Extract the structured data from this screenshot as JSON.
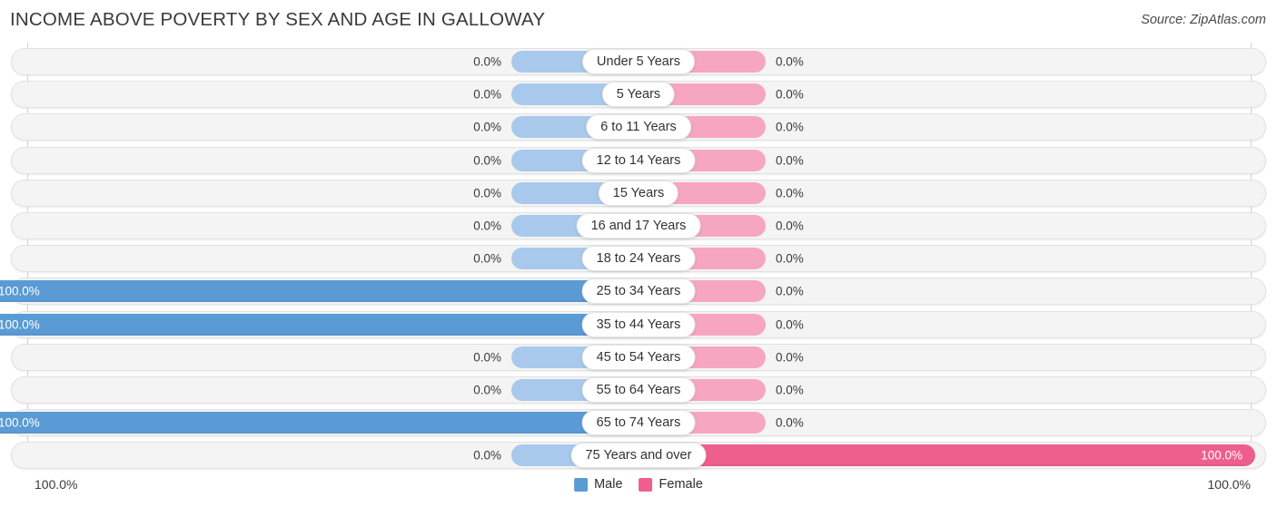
{
  "header": {
    "title": "INCOME ABOVE POVERTY BY SEX AND AGE IN GALLOWAY",
    "source": "Source: ZipAtlas.com"
  },
  "legend": {
    "male_label": "Male",
    "female_label": "Female",
    "male_color": "#5b9bd5",
    "female_color": "#ef5f8d"
  },
  "axis": {
    "left_label": "100.0%",
    "right_label": "100.0%"
  },
  "colors": {
    "male_light": "#a9c9ec",
    "male_full": "#5b9bd5",
    "female_light": "#f7a6c2",
    "female_full": "#ef5f8d",
    "track": "#f4f4f4"
  },
  "chart_data": {
    "type": "bar",
    "title": "INCOME ABOVE POVERTY BY SEX AND AGE IN GALLOWAY",
    "subtitle": "Source: ZipAtlas.com",
    "orientation": "horizontal",
    "style": "diverging-bidirectional",
    "xlabel": "",
    "ylabel": "",
    "xlim": [
      0,
      100
    ],
    "grid": false,
    "legend_position": "bottom-center",
    "axis_left_max": "100.0%",
    "axis_right_max": "100.0%",
    "categories": [
      "Under 5 Years",
      "5 Years",
      "6 to 11 Years",
      "12 to 14 Years",
      "15 Years",
      "16 and 17 Years",
      "18 to 24 Years",
      "25 to 34 Years",
      "35 to 44 Years",
      "45 to 54 Years",
      "55 to 64 Years",
      "65 to 74 Years",
      "75 Years and over"
    ],
    "series": [
      {
        "name": "Male",
        "values": [
          0.0,
          0.0,
          0.0,
          0.0,
          0.0,
          0.0,
          0.0,
          100.0,
          100.0,
          0.0,
          0.0,
          100.0,
          0.0
        ]
      },
      {
        "name": "Female",
        "values": [
          0.0,
          0.0,
          0.0,
          0.0,
          0.0,
          0.0,
          0.0,
          0.0,
          0.0,
          0.0,
          0.0,
          0.0,
          100.0
        ]
      }
    ]
  },
  "rows": [
    {
      "label": "Under 5 Years",
      "male_value": "0.0%",
      "female_value": "0.0%",
      "male_pct": 0,
      "female_pct": 0
    },
    {
      "label": "5 Years",
      "male_value": "0.0%",
      "female_value": "0.0%",
      "male_pct": 0,
      "female_pct": 0
    },
    {
      "label": "6 to 11 Years",
      "male_value": "0.0%",
      "female_value": "0.0%",
      "male_pct": 0,
      "female_pct": 0
    },
    {
      "label": "12 to 14 Years",
      "male_value": "0.0%",
      "female_value": "0.0%",
      "male_pct": 0,
      "female_pct": 0
    },
    {
      "label": "15 Years",
      "male_value": "0.0%",
      "female_value": "0.0%",
      "male_pct": 0,
      "female_pct": 0
    },
    {
      "label": "16 and 17 Years",
      "male_value": "0.0%",
      "female_value": "0.0%",
      "male_pct": 0,
      "female_pct": 0
    },
    {
      "label": "18 to 24 Years",
      "male_value": "0.0%",
      "female_value": "0.0%",
      "male_pct": 0,
      "female_pct": 0
    },
    {
      "label": "25 to 34 Years",
      "male_value": "100.0%",
      "female_value": "0.0%",
      "male_pct": 100,
      "female_pct": 0
    },
    {
      "label": "35 to 44 Years",
      "male_value": "100.0%",
      "female_value": "0.0%",
      "male_pct": 100,
      "female_pct": 0
    },
    {
      "label": "45 to 54 Years",
      "male_value": "0.0%",
      "female_value": "0.0%",
      "male_pct": 0,
      "female_pct": 0
    },
    {
      "label": "55 to 64 Years",
      "male_value": "0.0%",
      "female_value": "0.0%",
      "male_pct": 0,
      "female_pct": 0
    },
    {
      "label": "65 to 74 Years",
      "male_value": "100.0%",
      "female_value": "0.0%",
      "male_pct": 100,
      "female_pct": 0
    },
    {
      "label": "75 Years and over",
      "male_value": "0.0%",
      "female_value": "100.0%",
      "male_pct": 0,
      "female_pct": 100
    }
  ]
}
